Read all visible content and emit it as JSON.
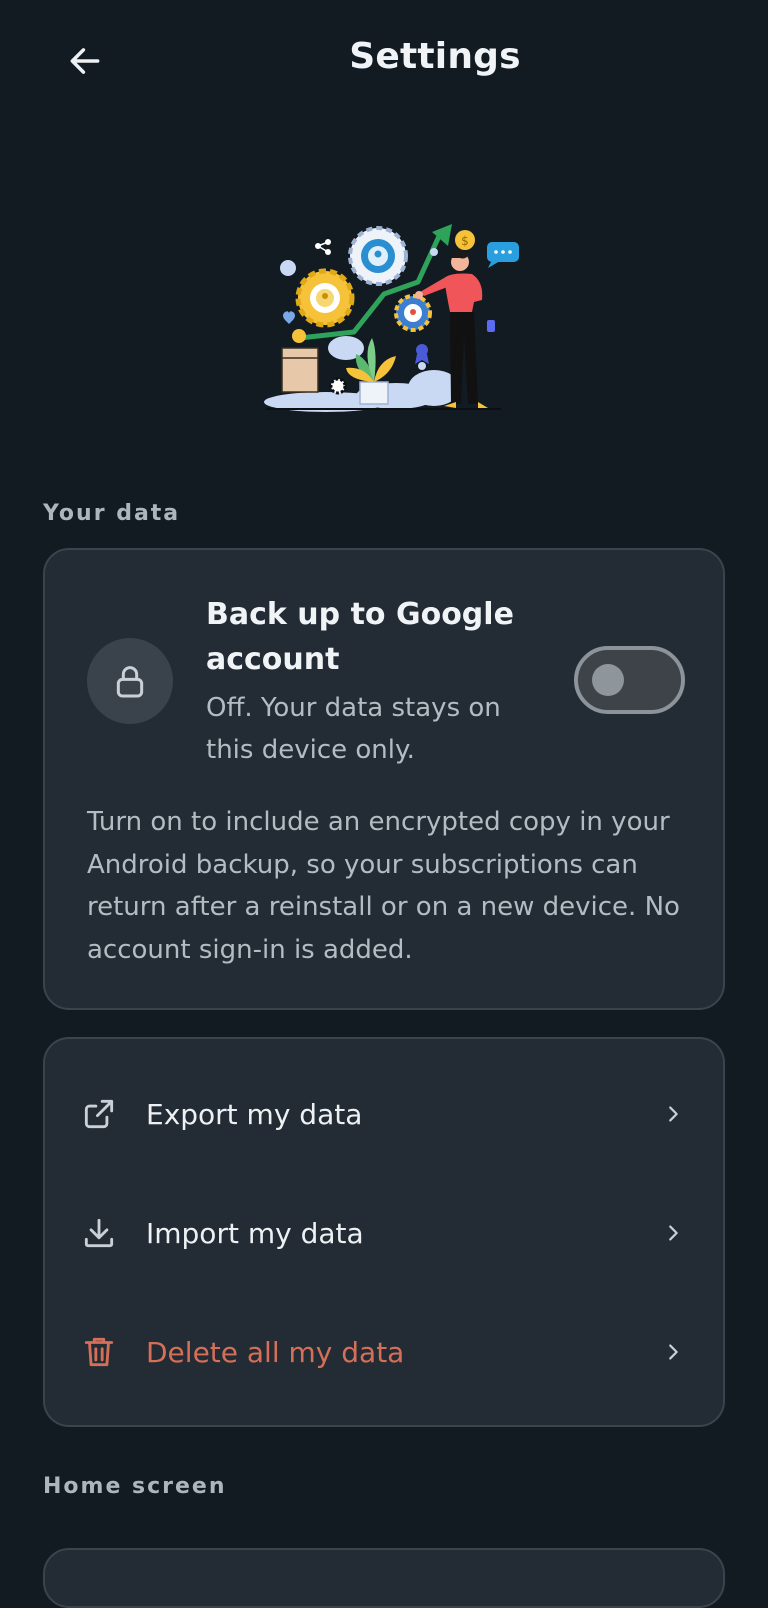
{
  "header": {
    "title": "Settings"
  },
  "sections": {
    "your_data": "Your data",
    "home_screen": "Home screen"
  },
  "backup": {
    "title": "Back up to Google account",
    "status": "Off. Your data stays on this device only.",
    "description": "Turn on to include an encrypted copy in your Android backup, so your subscriptions can return after a reinstall or on a new device. No account sign-in is added.",
    "toggle_on": false
  },
  "data_actions": [
    {
      "label": "Export my data",
      "icon": "export-icon"
    },
    {
      "label": "Import my data",
      "icon": "download-icon"
    },
    {
      "label": "Delete all my data",
      "icon": "trash-icon"
    }
  ],
  "colors": {
    "background": "#121a22",
    "card": "#232c34",
    "danger": "#d56f57",
    "accent_green": "#2fa35a",
    "figure_shirt": "#f0555a"
  }
}
